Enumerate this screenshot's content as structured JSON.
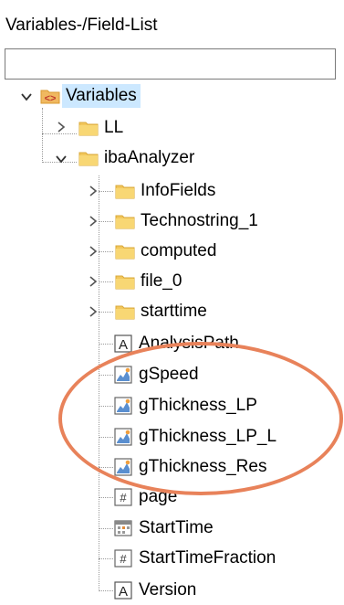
{
  "panel": {
    "title": "Variables-/Field-List"
  },
  "search": {
    "value": "",
    "placeholder": ""
  },
  "tree": {
    "root": {
      "label": "Variables",
      "icon": "variables-icon",
      "expanded": true
    },
    "ll": {
      "label": "LL",
      "icon": "folder-icon"
    },
    "analyzer": {
      "label": "ibaAnalyzer",
      "icon": "folder-icon",
      "expanded": true
    },
    "infofields": {
      "label": "InfoFields",
      "icon": "folder-icon"
    },
    "technostring": {
      "label": "Technostring_1",
      "icon": "folder-icon"
    },
    "computed": {
      "label": "computed",
      "icon": "folder-icon"
    },
    "file0": {
      "label": "file_0",
      "icon": "folder-icon"
    },
    "starttime_folder": {
      "label": "starttime",
      "icon": "folder-icon"
    },
    "analysispath": {
      "label": "AnalysisPath",
      "icon": "text-variable-icon"
    },
    "gspeed": {
      "label": "gSpeed",
      "icon": "signal-variable-icon"
    },
    "gthickness_lp": {
      "label": "gThickness_LP",
      "icon": "signal-variable-icon"
    },
    "gthickness_lp_l": {
      "label": "gThickness_LP_L",
      "icon": "signal-variable-icon"
    },
    "gthickness_res": {
      "label": "gThickness_Res",
      "icon": "signal-variable-icon"
    },
    "page": {
      "label": "page",
      "icon": "number-variable-icon"
    },
    "starttime": {
      "label": "StartTime",
      "icon": "datetime-variable-icon"
    },
    "starttimefraction": {
      "label": "StartTimeFraction",
      "icon": "number-variable-icon"
    },
    "version": {
      "label": "Version",
      "icon": "text-variable-icon"
    }
  },
  "colors": {
    "selection": "#cce8ff",
    "folder": "#f2c75c",
    "highlight_ellipse": "#e8825a",
    "root_icon": "#e6a23c"
  }
}
